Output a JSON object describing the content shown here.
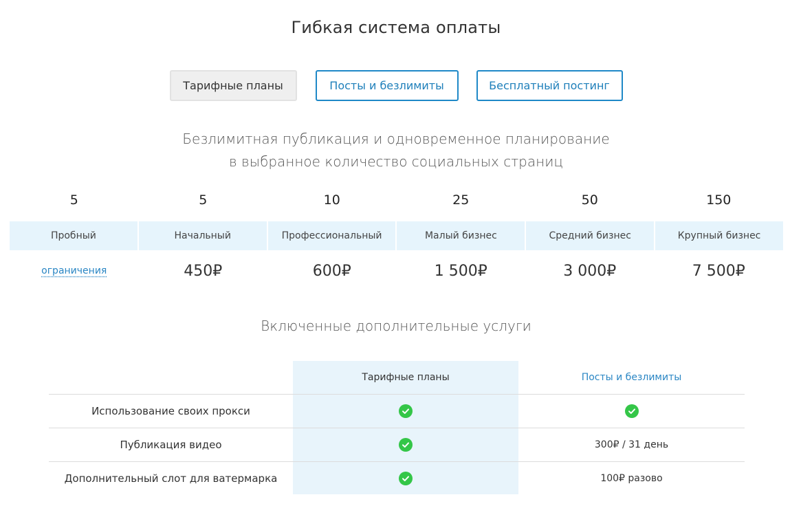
{
  "title": "Гибкая система оплаты",
  "tabs": [
    {
      "label": "Тарифные планы",
      "active": true
    },
    {
      "label": "Посты и безлимиты",
      "active": false
    },
    {
      "label": "Бесплатный постинг",
      "active": false
    }
  ],
  "subtitle_line1": "Безлимитная публикация и одновременное планирование",
  "subtitle_line2": "в выбранное количество социальных страниц",
  "plans": [
    {
      "count": "5",
      "name": "Пробный",
      "price": "ограничения"
    },
    {
      "count": "5",
      "name": "Начальный",
      "price": "450₽"
    },
    {
      "count": "10",
      "name": "Профессиональный",
      "price": "600₽"
    },
    {
      "count": "25",
      "name": "Малый бизнес",
      "price": "1 500₽"
    },
    {
      "count": "50",
      "name": "Средний бизнес",
      "price": "3 000₽"
    },
    {
      "count": "150",
      "name": "Крупный бизнес",
      "price": "7 500₽"
    }
  ],
  "services_title": "Включенные дополнительные услуги",
  "services": {
    "col2_header": "Тарифные планы",
    "col3_header": "Посты и безлимиты",
    "rows": [
      {
        "label": "Использование своих прокси",
        "col2": "check-icon",
        "col3": "check-icon"
      },
      {
        "label": "Публикация видео",
        "col2": "check-icon",
        "col3": "300₽ / 31 день"
      },
      {
        "label": "Дополнительный слот для ватермарка",
        "col2": "check-icon",
        "col3": "100₽  разово"
      }
    ]
  },
  "colors": {
    "accent": "#1e88c7",
    "check": "#34c648",
    "highlight": "#e6f4fc"
  }
}
